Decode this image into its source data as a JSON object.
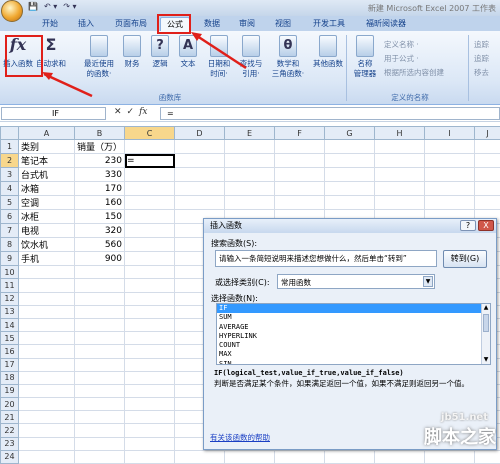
{
  "titlebar": {
    "qat_save": "💾",
    "qat_undo": "↶ ▾",
    "qat_redo": "↷ ▾",
    "title": "新建 Microsoft Excel 2007 工作表"
  },
  "tabs": [
    "开始",
    "插入",
    "页面布局",
    "公式",
    "数据",
    "审阅",
    "视图",
    "开发工具",
    "福昕阅读器"
  ],
  "ribbon": {
    "insert_function": {
      "label_line1": "插入函数",
      "icon": "fx"
    },
    "autosum": {
      "label_line1": "自动求和",
      "icon": "Σ"
    },
    "recent": {
      "label_line1": "最近使用",
      "label_line2": "的函数·"
    },
    "financial": {
      "label_line1": "财务",
      "label_line2": ""
    },
    "logical": {
      "label_line1": "逻辑",
      "label_line2": ""
    },
    "text": {
      "label_line1": "文本",
      "label_line2": ""
    },
    "datetime": {
      "label_line1": "日期和",
      "label_line2": "时间·"
    },
    "lookup": {
      "label_line1": "查找与",
      "label_line2": "引用·"
    },
    "math": {
      "label_line1": "数学和",
      "label_line2": "三角函数·"
    },
    "other": {
      "label_line1": "其他函数",
      "label_line2": ""
    },
    "function_library_label": "函数库",
    "name_manager": {
      "label_line1": "名称",
      "label_line2": "管理器"
    },
    "define_name": "定义名称 ·",
    "use_in_formula": "用于公式 ·",
    "create_from_selection": "根据所选内容创建",
    "defined_names_label": "定义的名称",
    "right_items": [
      "追踪",
      "追踪",
      "移去"
    ]
  },
  "formula_bar": {
    "name_box": "IF",
    "cancel": "✕",
    "enter": "✓",
    "fx": "fx",
    "content": "="
  },
  "grid": {
    "columns": [
      "A",
      "B",
      "C",
      "D",
      "E",
      "F",
      "G",
      "H",
      "I",
      "J"
    ],
    "rows": [
      {
        "n": "1",
        "a": "类别",
        "b": "销量（万）"
      },
      {
        "n": "2",
        "a": "笔记本",
        "b": "230",
        "c": "="
      },
      {
        "n": "3",
        "a": "台式机",
        "b": "330"
      },
      {
        "n": "4",
        "a": "冰箱",
        "b": "170"
      },
      {
        "n": "5",
        "a": "空调",
        "b": "160"
      },
      {
        "n": "6",
        "a": "冰柜",
        "b": "150"
      },
      {
        "n": "7",
        "a": "电视",
        "b": "320"
      },
      {
        "n": "8",
        "a": "饮水机",
        "b": "560"
      },
      {
        "n": "9",
        "a": "手机",
        "b": "900"
      },
      {
        "n": "10"
      },
      {
        "n": "11"
      },
      {
        "n": "12"
      },
      {
        "n": "13"
      },
      {
        "n": "14"
      },
      {
        "n": "15"
      },
      {
        "n": "16"
      },
      {
        "n": "17"
      },
      {
        "n": "18"
      },
      {
        "n": "19"
      },
      {
        "n": "20"
      },
      {
        "n": "21"
      },
      {
        "n": "22"
      },
      {
        "n": "23"
      },
      {
        "n": "24"
      }
    ]
  },
  "dialog": {
    "title": "插入函数",
    "help_btn": "?",
    "close_btn": "X",
    "search_label": "搜索函数(S):",
    "search_value": "请输入一条简短说明来描述您想做什么，然后单击“转到”",
    "go_button": "转到(G)",
    "category_label": "或选择类别(C):",
    "category_value": "常用函数",
    "select_label": "选择函数(N):",
    "functions": [
      "IF",
      "SUM",
      "AVERAGE",
      "HYPERLINK",
      "COUNT",
      "MAX",
      "SIN"
    ],
    "selected_function": "IF",
    "syntax": "IF(logical_test,value_if_true,value_if_false)",
    "description": "判断是否满足某个条件，如果满足返回一个值，如果不满足则返回另一个值。",
    "help_link": "有关该函数的帮助"
  },
  "watermark": {
    "site": "jb51.net",
    "name": "脚本之家"
  },
  "colors": {
    "annotation_red": "#e0201a",
    "selection_blue": "#3399ff"
  }
}
